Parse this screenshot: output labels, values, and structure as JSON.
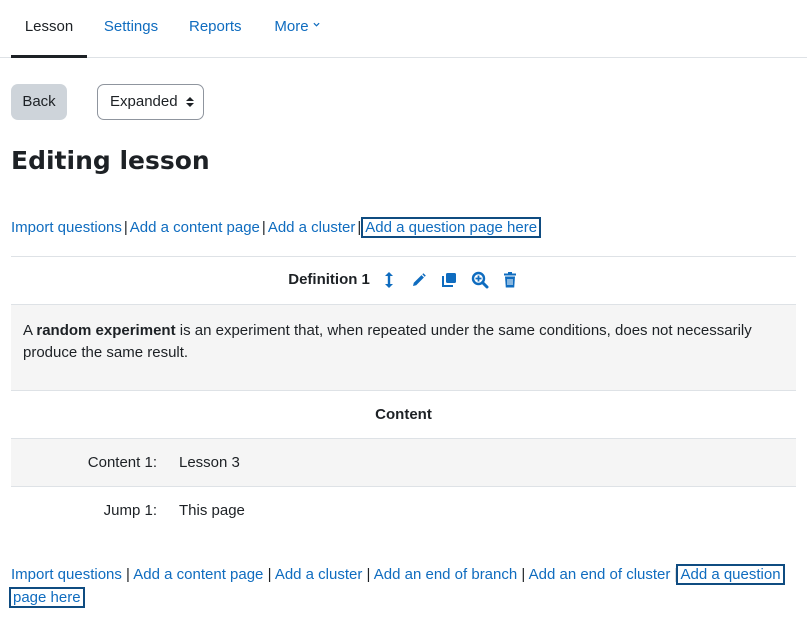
{
  "tabs": [
    {
      "label": "Lesson",
      "active": true
    },
    {
      "label": "Settings"
    },
    {
      "label": "Reports"
    },
    {
      "label": "More"
    }
  ],
  "back_label": "Back",
  "view_select": {
    "value": "Expanded"
  },
  "page_title": "Editing lesson",
  "top_links": [
    "Import questions",
    "Add a content page",
    "Add a cluster",
    "Add a question page here"
  ],
  "page": {
    "title": "Definition 1",
    "icons": [
      "move-icon",
      "edit-icon",
      "duplicate-icon",
      "preview-icon",
      "delete-icon"
    ],
    "desc_prefix": "A ",
    "desc_bold": "random experiment",
    "desc_rest": " is an experiment that, when repeated under the same conditions, does not necessarily",
    "desc_line2": "produce the same result.",
    "content_header": "Content",
    "rows": [
      {
        "label": "Content 1:",
        "value": "Lesson 3"
      },
      {
        "label": "Jump 1:",
        "value": "This page"
      }
    ]
  },
  "bottom_links": [
    "Import questions",
    "Add a content page",
    "Add a cluster",
    "Add an end of branch",
    "Add an end of cluster",
    "Add a question page here"
  ],
  "bottom_last_line1": "Add a question",
  "bottom_last_line2": "page here",
  "colors": {
    "link": "#0f6cbf",
    "icon": "#0f6cbf",
    "focus": "#0f4c81"
  }
}
